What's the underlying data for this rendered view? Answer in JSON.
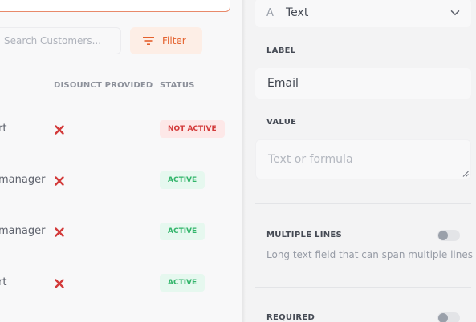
{
  "table": {
    "search_placeholder": "Search Customers...",
    "filter_label": "Filter",
    "columns": {
      "discount": "DISOUNCT PROVIDED",
      "status": "STATUS"
    },
    "rows": [
      {
        "name": "rt",
        "status": "NOT ACTIVE",
        "status_type": "off"
      },
      {
        "name": "manager",
        "status": "ACTIVE",
        "status_type": "on"
      },
      {
        "name": "manager",
        "status": "ACTIVE",
        "status_type": "on"
      },
      {
        "name": "rt",
        "status": "ACTIVE",
        "status_type": "on"
      }
    ]
  },
  "properties": {
    "type_value": "Text",
    "type_icon": "A",
    "label_heading": "LABEL",
    "label_value": "Email",
    "value_heading": "VALUE",
    "value_placeholder": "Text or formula",
    "multiple_lines": {
      "heading": "MULTIPLE LINES",
      "help": "Long text field that can span multiple lines",
      "enabled": false
    },
    "required": {
      "heading": "REQUIRED",
      "enabled": false
    }
  },
  "colors": {
    "accent": "#e4612d",
    "danger": "#d33a3a",
    "success": "#33b56b"
  }
}
